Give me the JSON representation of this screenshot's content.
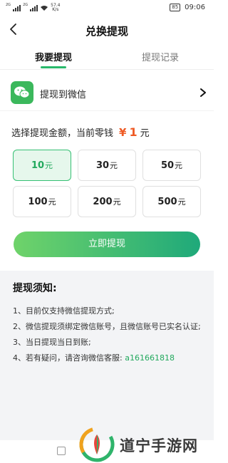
{
  "status": {
    "sim1": "2G",
    "sim2": "2G",
    "speed_value": "57.4",
    "speed_unit": "K/s",
    "battery": "85",
    "time": "09:06"
  },
  "header": {
    "title": "兑换提现"
  },
  "tabs": [
    {
      "label": "我要提现",
      "active": true
    },
    {
      "label": "提现记录",
      "active": false
    }
  ],
  "method": {
    "label": "提现到微信",
    "icon": "wechat-icon"
  },
  "amount": {
    "prompt": "选择提现金额，当前零钱",
    "currency": "¥",
    "value": "1",
    "unit": "元"
  },
  "options": [
    {
      "value": "10",
      "unit": "元",
      "selected": true
    },
    {
      "value": "30",
      "unit": "元"
    },
    {
      "value": "50",
      "unit": "元"
    },
    {
      "value": "100",
      "unit": "元"
    },
    {
      "value": "200",
      "unit": "元"
    },
    {
      "value": "500",
      "unit": "元"
    }
  ],
  "submit_label": "立即提现",
  "notice": {
    "title": "提现须知:",
    "items": [
      "1、目前仅支持微信提现方式;",
      "2、微信提现须绑定微信账号，且微信账号已实名认证;",
      "3、当日提现当日到账;"
    ],
    "item4_prefix": "4、若有疑问，请咨询微信客服:",
    "item4_contact": "a161661818"
  },
  "watermark": {
    "text": "道宁手游网"
  },
  "colors": {
    "accent": "#29b96b",
    "money": "#ee5a24",
    "wechat": "#3bb85c"
  }
}
